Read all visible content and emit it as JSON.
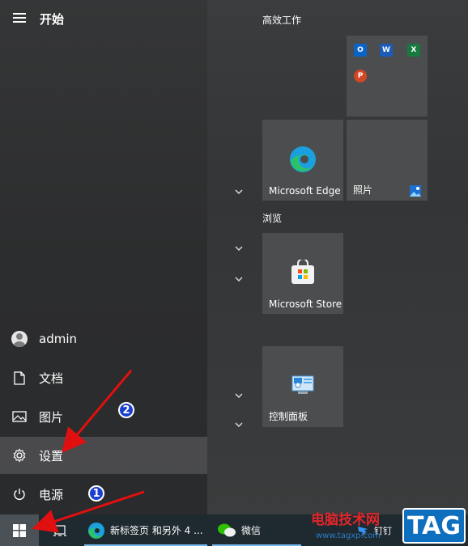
{
  "start_menu": {
    "title": "开始",
    "user": "admin",
    "items": [
      {
        "label": "文档",
        "icon": "document-icon"
      },
      {
        "label": "图片",
        "icon": "pictures-icon"
      },
      {
        "label": "设置",
        "icon": "gear-icon"
      },
      {
        "label": "电源",
        "icon": "power-icon"
      }
    ]
  },
  "tiles": {
    "groups": [
      {
        "title": "高效工作"
      },
      {
        "title": "浏览"
      }
    ],
    "office_folder": [
      "outlook-icon",
      "word-icon",
      "excel-icon",
      "powerpoint-icon"
    ],
    "edge": "Microsoft Edge",
    "photos": "照片",
    "store": "Microsoft Store",
    "control_panel": "控制面板"
  },
  "taskbar": {
    "apps": [
      {
        "label": "新标签页 和另外 4 ...",
        "icon": "edge-icon"
      },
      {
        "label": "微信",
        "icon": "wechat-icon"
      },
      {
        "label": "钉钉",
        "icon": "dingtalk-icon"
      }
    ]
  },
  "annotations": {
    "badge1": "1",
    "badge2": "2",
    "arrow_color": "#e01010"
  },
  "watermark": {
    "site": "电脑技术网",
    "url": "www.tagxp.com",
    "tag": "TAG"
  }
}
